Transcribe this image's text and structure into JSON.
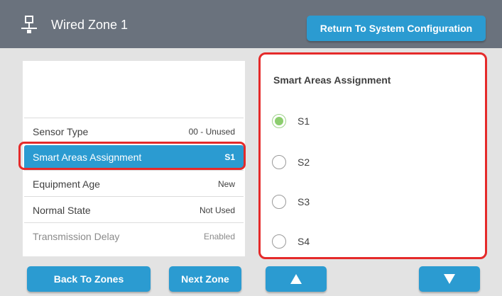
{
  "header": {
    "title": "Wired Zone 1",
    "icon": "network-icon",
    "return_label": "Return To System Configuration"
  },
  "settings": {
    "rows": [
      {
        "label": "Sensor Type",
        "value": "00 - Unused"
      },
      {
        "label": "Smart Areas Assignment",
        "value": "S1"
      },
      {
        "label": "Equipment Age",
        "value": "New"
      },
      {
        "label": "Normal State",
        "value": "Not Used"
      },
      {
        "label": "Transmission Delay",
        "value": "Enabled"
      }
    ]
  },
  "assignment": {
    "title": "Smart Areas Assignment",
    "options": [
      {
        "label": "S1",
        "selected": true
      },
      {
        "label": "S2",
        "selected": false
      },
      {
        "label": "S3",
        "selected": false
      },
      {
        "label": "S4",
        "selected": false
      }
    ]
  },
  "footer": {
    "back_label": "Back To Zones",
    "next_label": "Next Zone",
    "up_icon": "arrow-up-icon",
    "down_icon": "arrow-down-icon"
  },
  "colors": {
    "header_bg": "#6a727d",
    "accent": "#2b9bd1",
    "highlight": "#e52a2a",
    "radio_selected": "#8ccd6e"
  }
}
